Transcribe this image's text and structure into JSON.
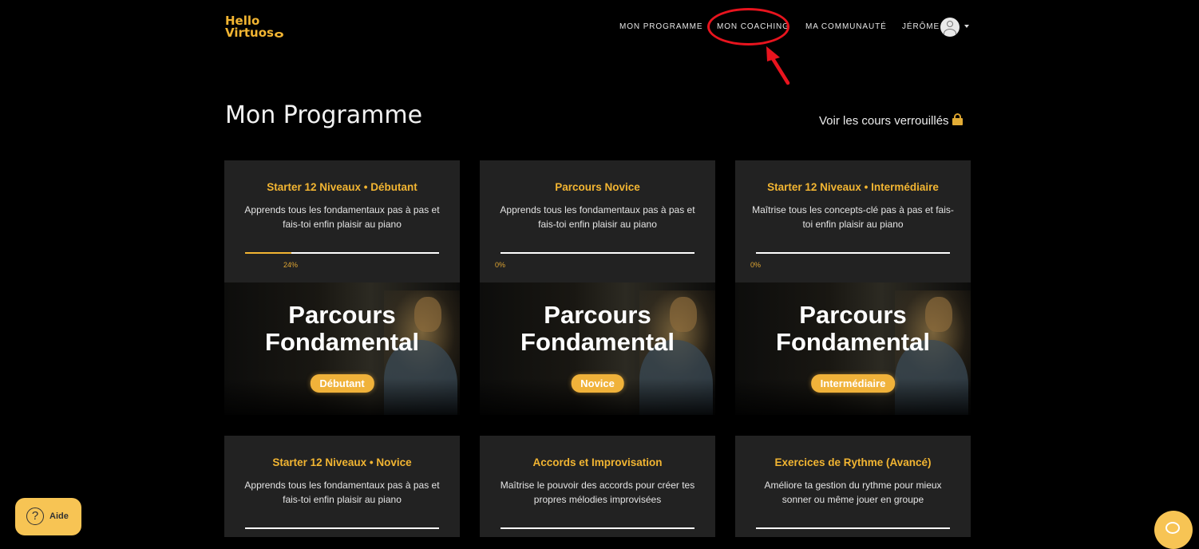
{
  "header": {
    "logo_line1": "Hello",
    "logo_line2": "Virtuos",
    "nav": [
      "MON PROGRAMME",
      "MON COACHING",
      "MA COMMUNAUTÉ",
      "JÉRÔME"
    ]
  },
  "main": {
    "title": "Mon Programme",
    "locked_link": "Voir les cours verrouillés"
  },
  "cards": [
    {
      "title": "Starter 12 Niveaux • Débutant",
      "desc": "Apprends tous les fondamentaux pas à pas et fais-toi enfin plaisir au piano",
      "progress": 0.24,
      "progress_label": "24%",
      "banner_title_1": "Parcours",
      "banner_title_2": "Fondamental",
      "level": "Débutant"
    },
    {
      "title": "Parcours Novice",
      "desc": "Apprends tous les fondamentaux pas à pas et fais-toi enfin plaisir au piano",
      "progress": 0,
      "progress_label": "0%",
      "banner_title_1": "Parcours",
      "banner_title_2": "Fondamental",
      "level": "Novice"
    },
    {
      "title": "Starter 12 Niveaux • Intermédiaire",
      "desc": "Maîtrise tous les concepts-clé pas à pas et fais-toi enfin plaisir au piano",
      "progress": 0,
      "progress_label": "0%",
      "banner_title_1": "Parcours",
      "banner_title_2": "Fondamental",
      "level": "Intermédiaire"
    },
    {
      "title": "Starter 12 Niveaux • Novice",
      "desc": "Apprends tous les fondamentaux pas à pas et fais-toi enfin plaisir au piano"
    },
    {
      "title": "Accords et Improvisation",
      "desc": "Maîtrise le pouvoir des accords pour créer tes propres mélodies improvisées"
    },
    {
      "title": "Exercices de Rythme (Avancé)",
      "desc": "Améliore ta gestion du rythme pour mieux sonner ou même jouer en groupe"
    }
  ],
  "help": {
    "label": "Aide"
  },
  "icons": {
    "lock": "lock-icon",
    "help": "question-icon",
    "chat": "chat-icon",
    "avatar": "user-avatar-icon"
  },
  "colors": {
    "accent": "#f2b532",
    "annotation": "#e8141e",
    "card_bg": "#222222",
    "page_bg": "#000000"
  }
}
